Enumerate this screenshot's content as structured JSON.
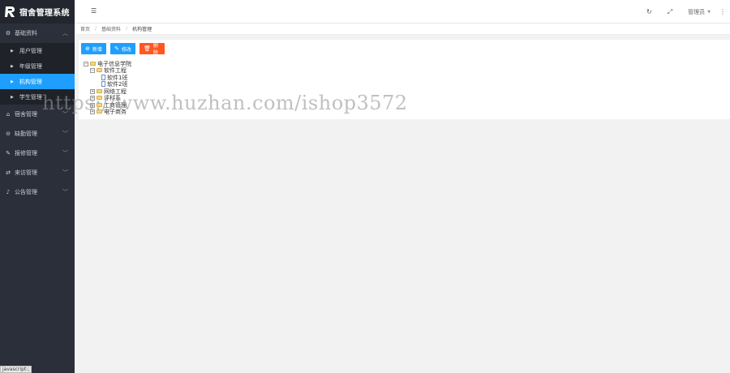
{
  "app": {
    "title": "宿舍管理系统"
  },
  "sidebar": {
    "groups": [
      {
        "label": "基础资料",
        "icon": "gear-icon",
        "expanded": true,
        "items": [
          {
            "label": "用户管理"
          },
          {
            "label": "年级管理"
          },
          {
            "label": "机构管理",
            "active": true
          },
          {
            "label": "学生管理"
          }
        ]
      },
      {
        "label": "宿舍管理",
        "icon": "home-icon"
      },
      {
        "label": "缺勤管理",
        "icon": "minus-circle-icon"
      },
      {
        "label": "报修管理",
        "icon": "wrench-icon"
      },
      {
        "label": "来访管理",
        "icon": "handshake-icon"
      },
      {
        "label": "公告管理",
        "icon": "bell-icon"
      }
    ]
  },
  "header": {
    "user": "管理员"
  },
  "breadcrumb": {
    "home": "首页",
    "level1": "基础资料",
    "current": "机构管理"
  },
  "toolbar": {
    "add": "新增",
    "edit": "修改",
    "delete": "删除"
  },
  "tree": {
    "root": "电子信息学院",
    "n1": "软件工程",
    "n1a": "软件1班",
    "n1b": "软件2班",
    "n2": "网络工程",
    "n3": "评科系",
    "n4": "工商管理",
    "n5": "电子商务"
  },
  "watermark": "https://www.huzhan.com/ishop3572",
  "statusbar": "javascript:;",
  "colors": {
    "accent": "#1e9fff",
    "danger": "#ff5722",
    "sidebar": "#2b2f3a"
  }
}
